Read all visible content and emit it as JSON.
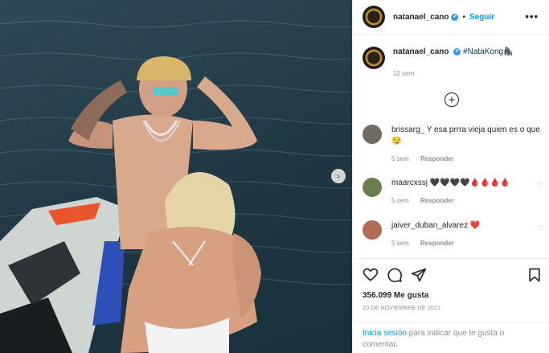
{
  "post": {
    "username": "natanael_cano",
    "verified_mark": "✔",
    "separator": "•",
    "follow_label": "Seguir",
    "more_label": "•••"
  },
  "caption": {
    "username": "natanael_cano",
    "text": "#NataKong",
    "emoji": "🦍",
    "time": "12 sem"
  },
  "load_more_label": "+",
  "comments": [
    {
      "username": "brissarg_",
      "text": "Y esa prrra vieja quien es o que 😏",
      "time": "5 sem",
      "reply_label": "Responder",
      "avatar_color": "#6f6a62"
    },
    {
      "username": "maarcxssj",
      "text": "🖤🖤🖤🖤🩸🩸🩸🩸",
      "time": "5 sem",
      "reply_label": "Responder",
      "avatar_color": "#6b7f4e"
    },
    {
      "username": "jaiver_duban_alvarez",
      "text": "❤️",
      "time": "5 sem",
      "reply_label": "Responder",
      "avatar_color": "#b06b52"
    }
  ],
  "likes": "356.099 Me gusta",
  "date": "20 DE NOVIEMBRE DE 2021",
  "login": {
    "link": "Inicia sesión",
    "rest": " para indicar que te gusta o comentar."
  },
  "icons": {
    "like": "heart-icon",
    "comment": "comment-icon",
    "share": "paper-plane-icon",
    "save": "bookmark-icon",
    "carousel": "chevron-right-icon"
  },
  "colors": {
    "accent": "#0095f6",
    "verified": "#3897f0",
    "muted": "#8e8e8e",
    "water": "#1f3641"
  }
}
